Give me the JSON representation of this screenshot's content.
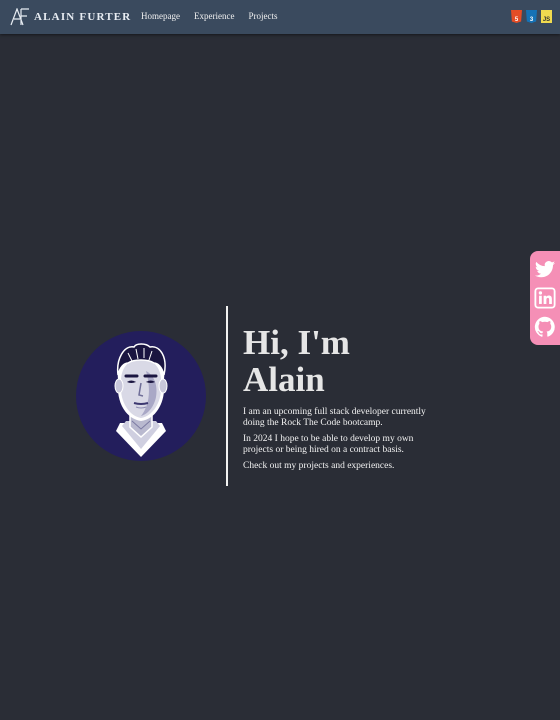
{
  "brand": {
    "name": "ALAIN FURTER"
  },
  "nav": {
    "items": [
      "Homepage",
      "Experience",
      "Projects"
    ]
  },
  "tech": {
    "html": "5",
    "css": "3",
    "js": "JS"
  },
  "social": {
    "items": [
      "twitter-icon",
      "linkedin-icon",
      "github-icon"
    ],
    "color": "#f58fb6"
  },
  "hero": {
    "heading": "Hi, I'm Alain",
    "paragraphs": [
      "I am an upcoming full stack developer currently doing the Rock The Code bootcamp.",
      "In 2024 I hope to be able to develop my own projects or being hired on a contract basis.",
      "Check out my projects and experiences."
    ]
  },
  "colors": {
    "background": "#2a2d36",
    "header": "#3a4a5e",
    "accent": "#f58fb6",
    "avatar_bg": "#231e5c"
  }
}
